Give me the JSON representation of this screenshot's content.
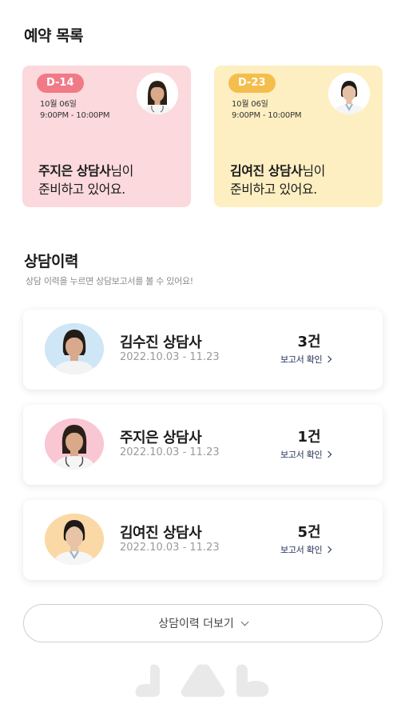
{
  "reservations": {
    "title": "예약 목록",
    "cards": [
      {
        "dday": "D-14",
        "date": "10월 06일",
        "time": "9:00PM - 10:00PM",
        "counselor": "주지은 상담사",
        "suffix": "님이",
        "line2": "준비하고 있어요.",
        "theme": "#fbd9dc"
      },
      {
        "dday": "D-23",
        "date": "10월 06일",
        "time": "9:00PM - 10:00PM",
        "counselor": "김여진 상담사",
        "suffix": "님이",
        "line2": "준비하고 있어요.",
        "theme": "#fdefc2"
      }
    ]
  },
  "history": {
    "title": "상담이력",
    "subtitle": "상담 이력을 누르면 상담보고서를 볼 수 있어요!",
    "items": [
      {
        "name": "김수진 상담사",
        "period": "2022.10.03 - 11.23",
        "count": "3건",
        "report": "보고서 확인",
        "avatar_bg": "#cfe6f7"
      },
      {
        "name": "주지은 상담사",
        "period": "2022.10.03 - 11.23",
        "count": "1건",
        "report": "보고서 확인",
        "avatar_bg": "#f9c6d3"
      },
      {
        "name": "김여진 상담사",
        "period": "2022.10.03 - 11.23",
        "count": "5건",
        "report": "보고서 확인",
        "avatar_bg": "#fbd9a6"
      }
    ],
    "more_label": "상담이력 더보기"
  },
  "colors": {
    "accent_pink": "#f07a86",
    "accent_yellow": "#f5be4c",
    "navy": "#1f2a55"
  },
  "icons": [
    "counselor-avatar-icon",
    "chevron-right-icon",
    "chevron-down-icon",
    "brand-logo-icon"
  ]
}
